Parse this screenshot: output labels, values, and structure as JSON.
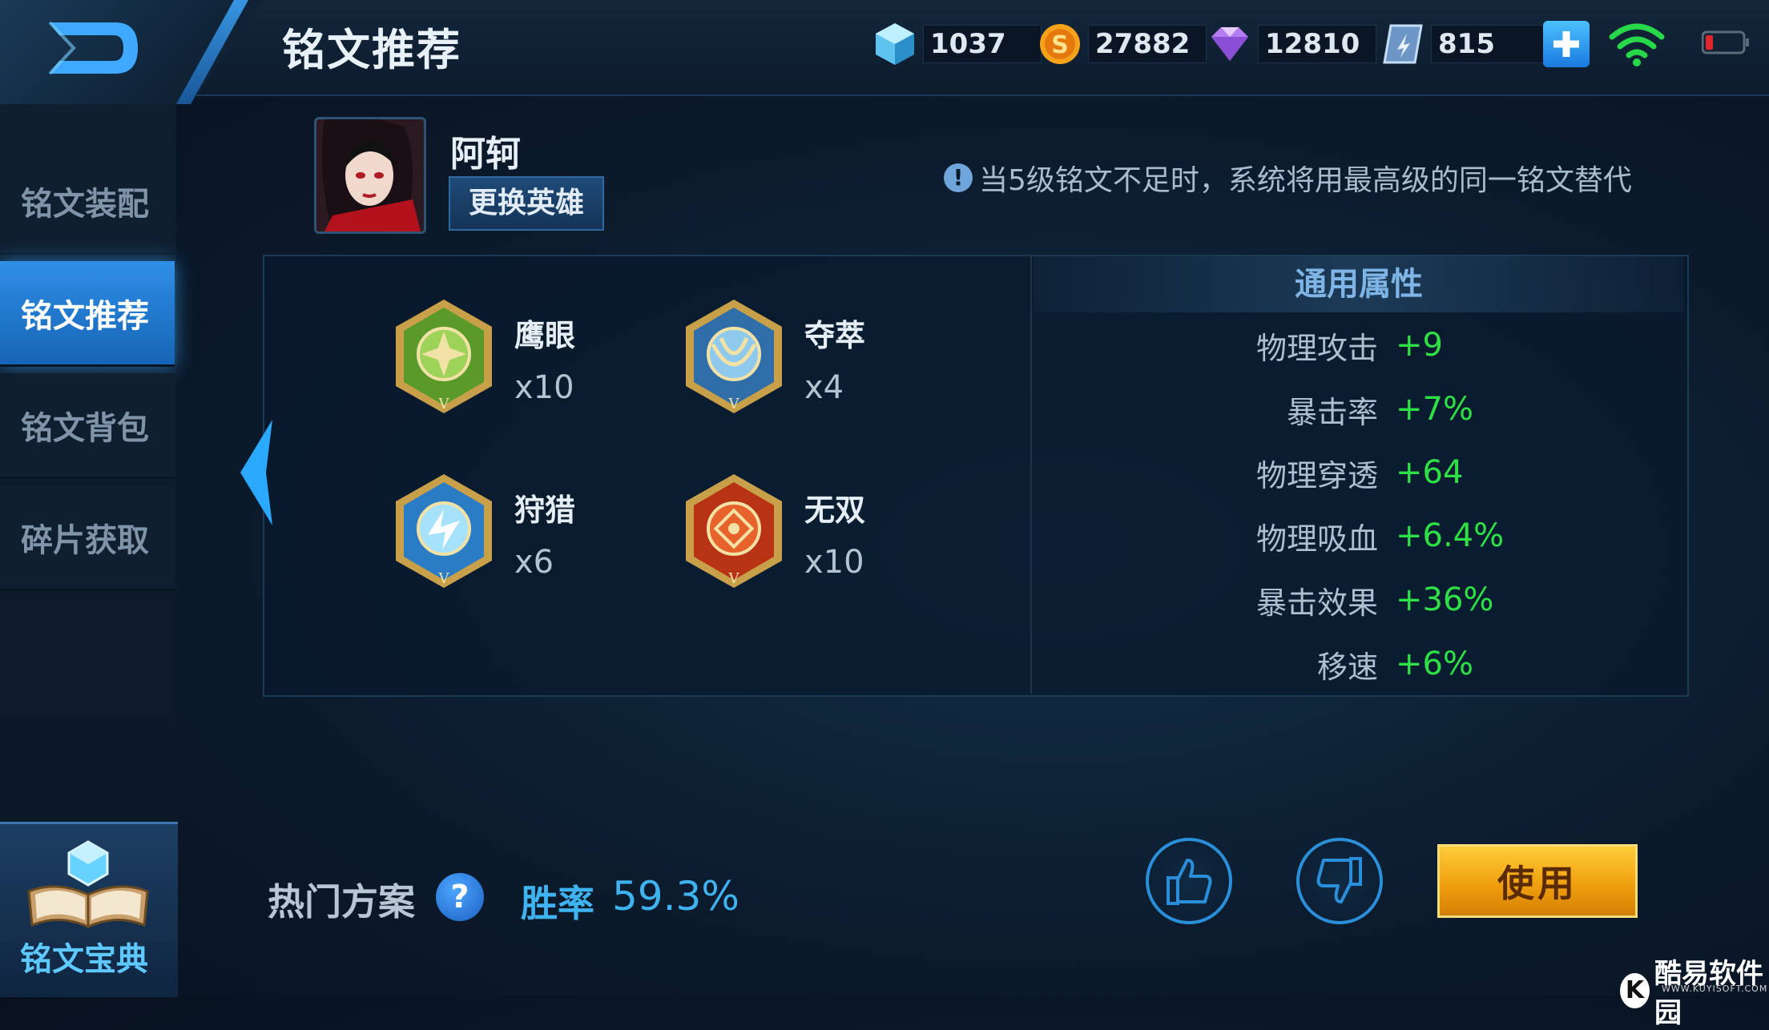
{
  "header": {
    "title": "铭文推荐",
    "currencies": [
      {
        "name": "crystal",
        "value": "1037",
        "icon": "crystal-icon",
        "color": "#7fd3ff"
      },
      {
        "name": "gold",
        "value": "27882",
        "icon": "gold-coin-icon",
        "color": "#f7a21b"
      },
      {
        "name": "diamond",
        "value": "12810",
        "icon": "diamond-icon",
        "color": "#c58cff"
      },
      {
        "name": "voucher",
        "value": "815",
        "icon": "voucher-icon",
        "color": "#8fb6e6"
      }
    ]
  },
  "sidebar": {
    "items": [
      {
        "label": "铭文装配",
        "active": false
      },
      {
        "label": "铭文推荐",
        "active": true
      },
      {
        "label": "铭文背包",
        "active": false
      },
      {
        "label": "碎片获取",
        "active": false
      }
    ],
    "codex_label": "铭文宝典"
  },
  "hero": {
    "name": "阿轲",
    "change_label": "更换英雄"
  },
  "notice": "当5级铭文不足时，系统将用最高级的同一铭文替代",
  "runes": [
    {
      "name": "鹰眼",
      "count": "x10",
      "color": "#5a9a2a",
      "icon": "eagle-eye-rune-icon"
    },
    {
      "name": "夺萃",
      "count": "x4",
      "color": "#4a8fcf",
      "icon": "plunder-rune-icon"
    },
    {
      "name": "狩猎",
      "count": "x6",
      "color": "#3c8fd6",
      "icon": "hunt-rune-icon"
    },
    {
      "name": "无双",
      "count": "x10",
      "color": "#d4411c",
      "icon": "peerless-rune-icon"
    }
  ],
  "stats": {
    "header": "通用属性",
    "rows": [
      {
        "name": "物理攻击",
        "value": "+9"
      },
      {
        "name": "暴击率",
        "value": "+7%"
      },
      {
        "name": "物理穿透",
        "value": "+64"
      },
      {
        "name": "物理吸血",
        "value": "+6.4%"
      },
      {
        "name": "暴击效果",
        "value": "+36%"
      },
      {
        "name": "移速",
        "value": "+6%"
      }
    ]
  },
  "footer": {
    "popular_label": "热门方案",
    "help_glyph": "?",
    "winrate_label": "胜率",
    "winrate_value": "59.3%",
    "use_label": "使用"
  },
  "watermark": {
    "badge": "K",
    "text": "酷易软件园",
    "sub": "WWW.KUYISOFT.COM"
  }
}
